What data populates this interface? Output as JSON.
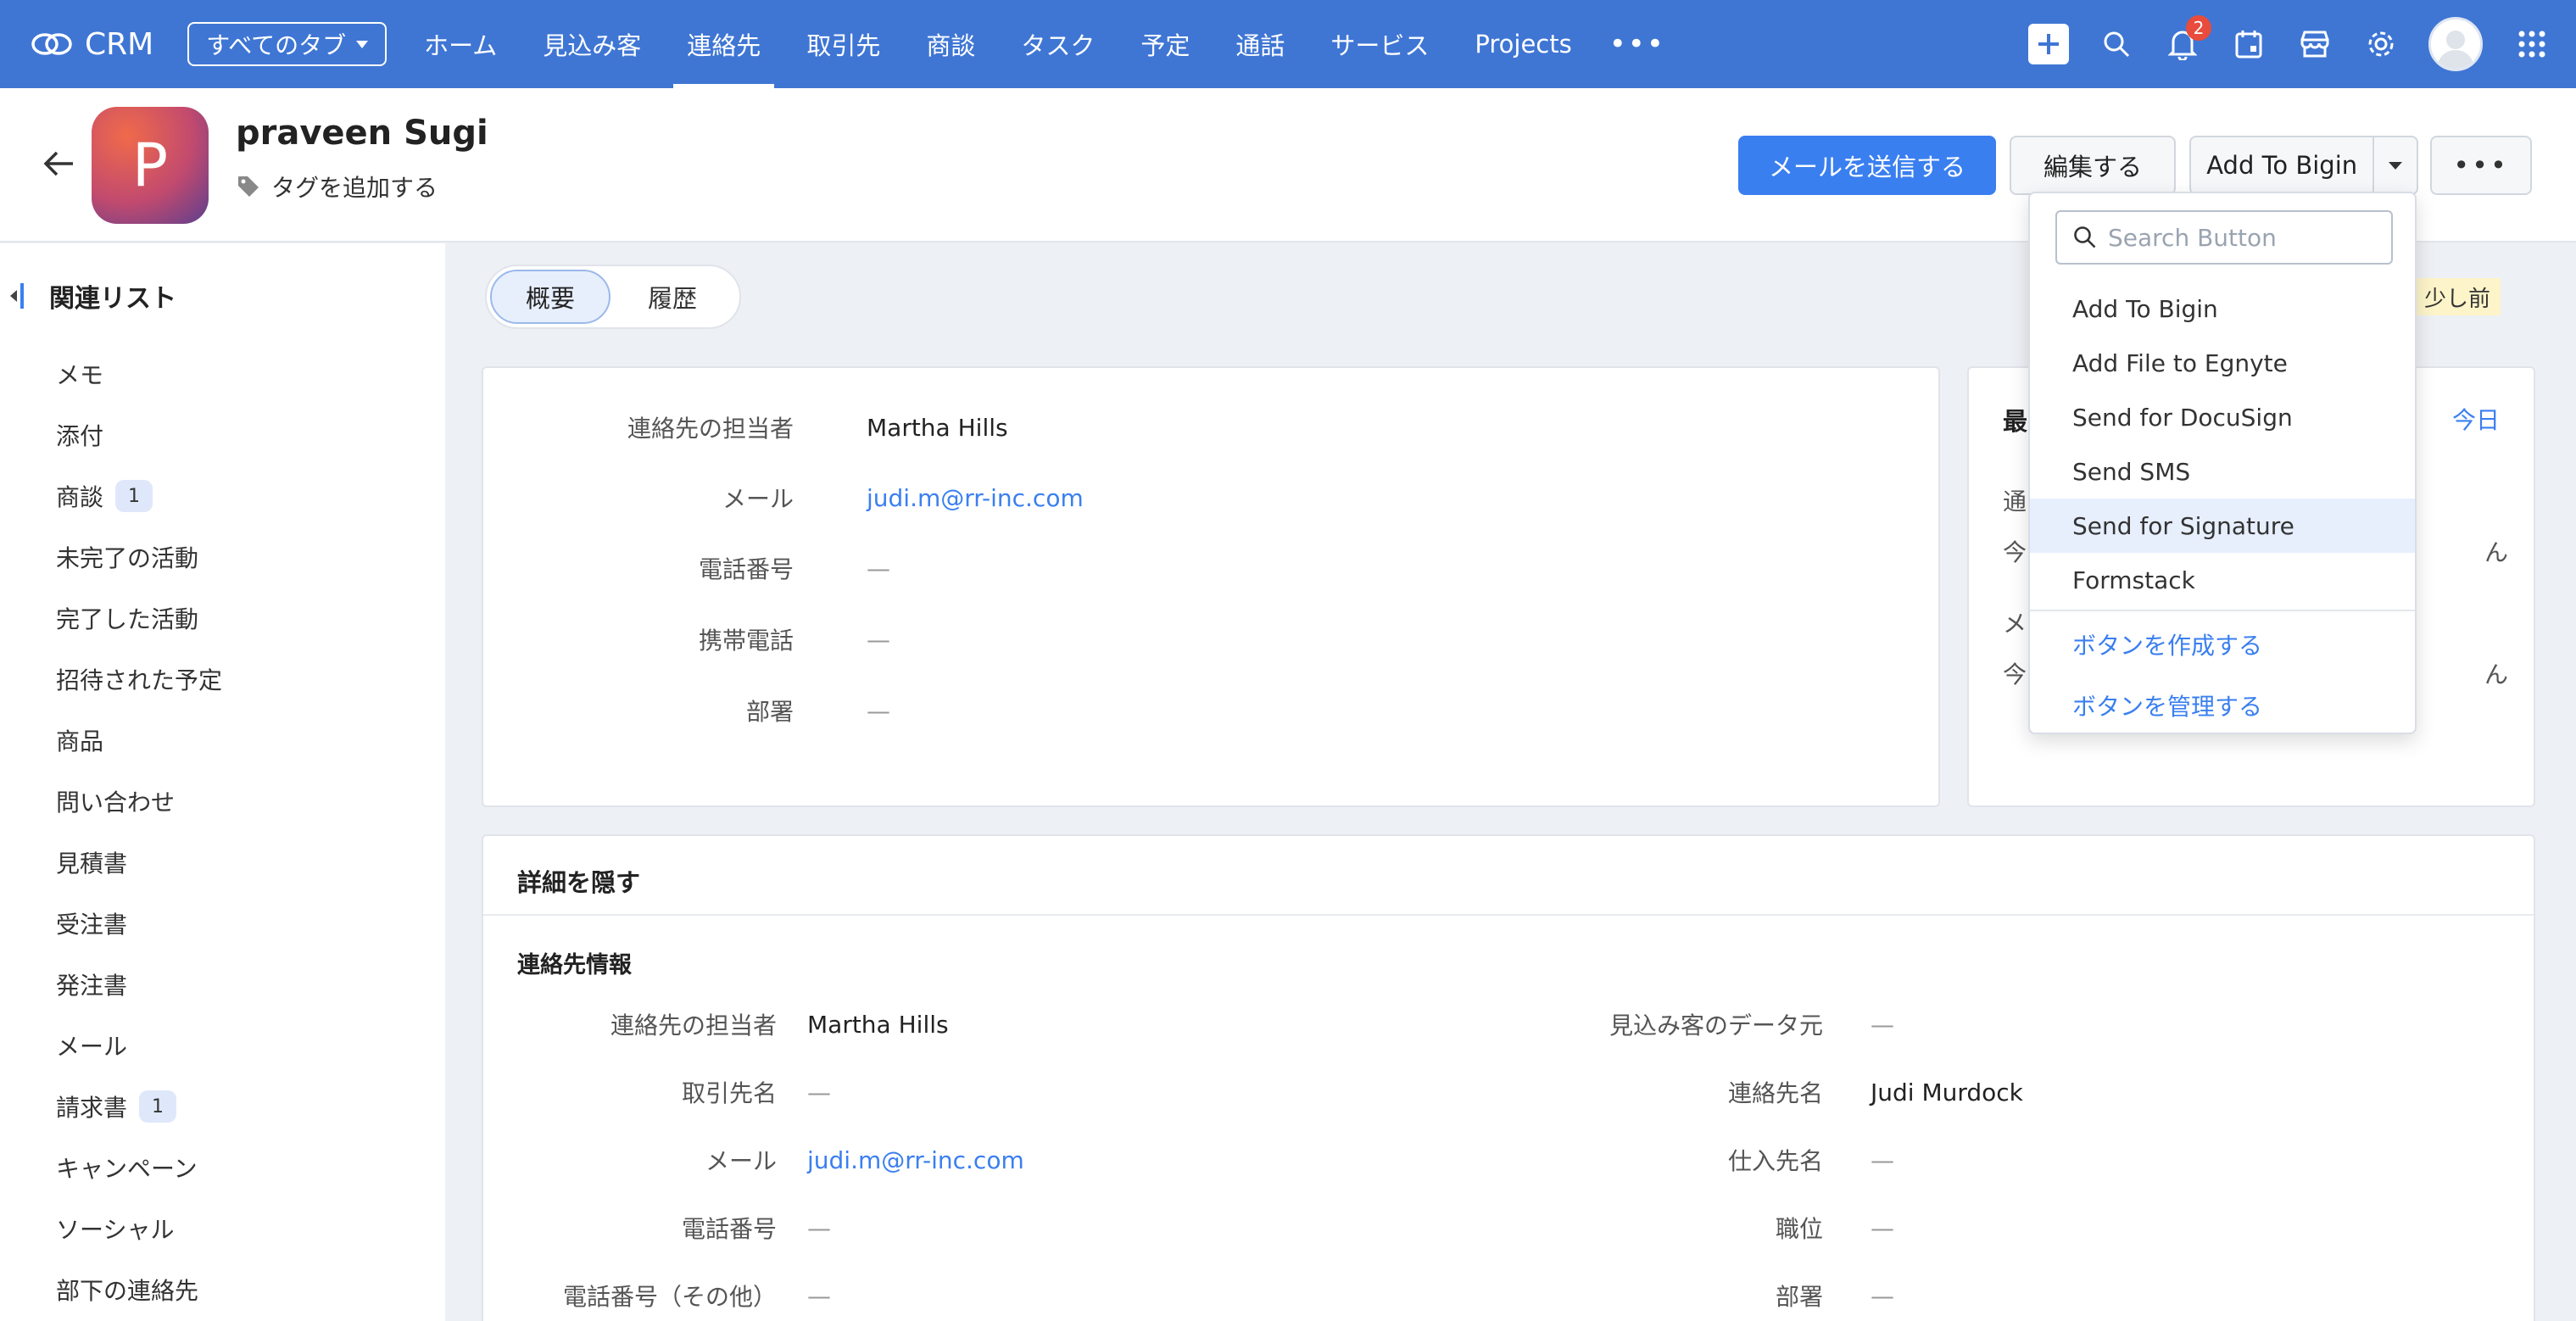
{
  "topnav": {
    "app_name": "CRM",
    "tabs_select": "すべてのタブ",
    "items": [
      "ホーム",
      "見込み客",
      "連絡先",
      "取引先",
      "商談",
      "タスク",
      "予定",
      "通話",
      "サービス",
      "Projects"
    ],
    "active_index": 2,
    "more": "•••",
    "notification_count": "2",
    "icons": [
      "plus-icon",
      "search-icon",
      "bell-icon",
      "calendar-icon",
      "store-icon",
      "gear-icon",
      "avatar",
      "apps-grid-icon"
    ],
    "accent_color": "#3f76d4"
  },
  "record": {
    "initial": "P",
    "name": "praveen Sugi",
    "add_tag": "タグを追加する",
    "send_email": "メールを送信する",
    "edit": "編集する",
    "add_to_bigin": "Add To Bigin",
    "more": "•••"
  },
  "sidebar": {
    "title": "関連リスト",
    "items": [
      {
        "label": "メモ",
        "count": ""
      },
      {
        "label": "添付",
        "count": ""
      },
      {
        "label": "商談",
        "count": "1"
      },
      {
        "label": "未完了の活動",
        "count": ""
      },
      {
        "label": "完了した活動",
        "count": ""
      },
      {
        "label": "招待された予定",
        "count": ""
      },
      {
        "label": "商品",
        "count": ""
      },
      {
        "label": "問い合わせ",
        "count": ""
      },
      {
        "label": "見積書",
        "count": ""
      },
      {
        "label": "受注書",
        "count": ""
      },
      {
        "label": "発注書",
        "count": ""
      },
      {
        "label": "メール",
        "count": ""
      },
      {
        "label": "請求書",
        "count": "1"
      },
      {
        "label": "キャンペーン",
        "count": ""
      },
      {
        "label": "ソーシャル",
        "count": ""
      },
      {
        "label": "部下の連絡先",
        "count": ""
      }
    ]
  },
  "view_toggle": {
    "overview": "概要",
    "history": "履歴"
  },
  "last_updated": ": 少し前",
  "summary": {
    "fields": [
      {
        "label": "連絡先の担当者",
        "value": "Martha Hills"
      },
      {
        "label": "メール",
        "value": "judi.m@rr-inc.com"
      },
      {
        "label": "電話番号",
        "value": "—"
      },
      {
        "label": "携帯電話",
        "value": "—"
      },
      {
        "label": "部署",
        "value": "—"
      }
    ]
  },
  "right_panel": {
    "title": "最",
    "today": "今日",
    "line1": "通",
    "line2": "今",
    "line2_end": "ん",
    "line3": "メ",
    "line4": "今",
    "line4_end": "ん"
  },
  "details": {
    "hide_details": "詳細を隠す",
    "section_title": "連絡先情報",
    "left": [
      {
        "label": "連絡先の担当者",
        "value": "Martha Hills"
      },
      {
        "label": "取引先名",
        "value": "—"
      },
      {
        "label": "メール",
        "value": "judi.m@rr-inc.com"
      },
      {
        "label": "電話番号",
        "value": "—"
      },
      {
        "label": "電話番号（その他）",
        "value": "—"
      }
    ],
    "right": [
      {
        "label": "見込み客のデータ元",
        "value": "—"
      },
      {
        "label": "連絡先名",
        "value": "Judi Murdock"
      },
      {
        "label": "仕入先名",
        "value": "—"
      },
      {
        "label": "職位",
        "value": "—"
      },
      {
        "label": "部署",
        "value": "—"
      }
    ]
  },
  "dropdown": {
    "search_placeholder": "Search Button",
    "items": [
      "Add To Bigin",
      "Add File to Egnyte",
      "Send for DocuSign",
      "Send SMS",
      "Send for Signature",
      "Formstack"
    ],
    "highlighted_index": 4,
    "create_button": "ボタンを作成する",
    "manage_buttons": "ボタンを管理する"
  }
}
